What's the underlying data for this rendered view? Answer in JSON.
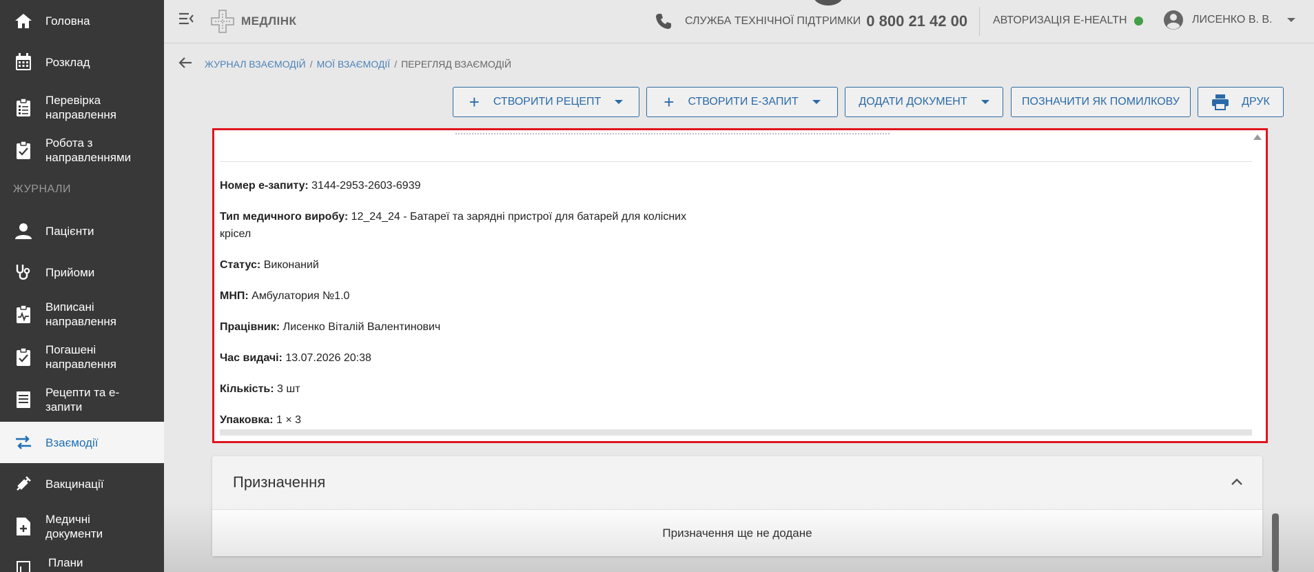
{
  "sidebar": {
    "items": [
      {
        "label": "Головна",
        "icon": "home-icon"
      },
      {
        "label": "Розклад",
        "icon": "calendar-icon"
      },
      {
        "label": "Перевірка направлення",
        "icon": "clipboard-list-icon"
      },
      {
        "label": "Робота з направленнями",
        "icon": "clipboard-check-icon"
      },
      {
        "label": "Пацієнти",
        "icon": "person-icon"
      },
      {
        "label": "Прийоми",
        "icon": "stethoscope-icon"
      },
      {
        "label": "Виписані направлення",
        "icon": "clipboard-pulse-icon"
      },
      {
        "label": "Погашені направлення",
        "icon": "clipboard-done-icon"
      },
      {
        "label": "Рецепти та е-запити",
        "icon": "receipt-icon"
      },
      {
        "label": "Взаємодії",
        "icon": "swap-arrows-icon"
      },
      {
        "label": "Вакцинації",
        "icon": "syringe-icon"
      },
      {
        "label": "Медичні документи",
        "icon": "file-plus-icon"
      },
      {
        "label": "Плани",
        "icon": "plan-icon"
      }
    ],
    "section_label": "ЖУРНАЛИ",
    "active_color": "#1f6fb5"
  },
  "header": {
    "logo_text": "МЕДЛІНК",
    "support_label": "СЛУЖБА ТЕХНІЧНОЇ ПІДТРИМКИ",
    "support_phone": "0 800 21 42 00",
    "ehealth_label": "АВТОРИЗАЦІЯ E-HEALTH",
    "ehealth_status_color": "#43a047",
    "user_name": "ЛИСЕНКО В. В."
  },
  "breadcrumb": {
    "items": [
      "ЖУРНАЛ ВЗАЄМОДІЙ",
      "МОЇ ВЗАЄМОДІЇ"
    ],
    "current": "ПЕРЕГЛЯД ВЗАЄМОДІЙ",
    "separator": "/"
  },
  "toolbar": {
    "create_recipe": "СТВОРИТИ РЕЦЕПТ",
    "create_erequest": "СТВОРИТИ Е-ЗАПИТ",
    "add_document": "ДОДАТИ ДОКУМЕНТ",
    "mark_error": "ПОЗНАЧИТИ ЯК ПОМИЛКОВУ",
    "print": "ДРУК"
  },
  "details": {
    "request_number_label": "Номер е-запиту:",
    "request_number": "3144-2953-2603-6939",
    "device_type_label": "Тип медичного виробу:",
    "device_type_line1": "12_24_24 - Батареї та зарядні пристрої для батарей для колісних",
    "device_type_line2": "крісел",
    "status_label": "Статус:",
    "status": "Виконаний",
    "mnp_label": "МНП:",
    "mnp": "Амбулатория №1.0",
    "worker_label": "Працівник:",
    "worker": "Лисенко Віталій Валентинович",
    "issue_time_label": "Час видачі:",
    "issue_time": "13.07.2026 20:38",
    "quantity_label": "Кількість:",
    "quantity": "3 шт",
    "package_label": "Упаковка:",
    "package": "1 × 3"
  },
  "assignments": {
    "title": "Призначення",
    "empty_text": "Призначення ще не додане"
  },
  "colors": {
    "accent": "#2a6aa8",
    "highlight_border": "#e0141e",
    "sidebar_bg": "#383838"
  }
}
